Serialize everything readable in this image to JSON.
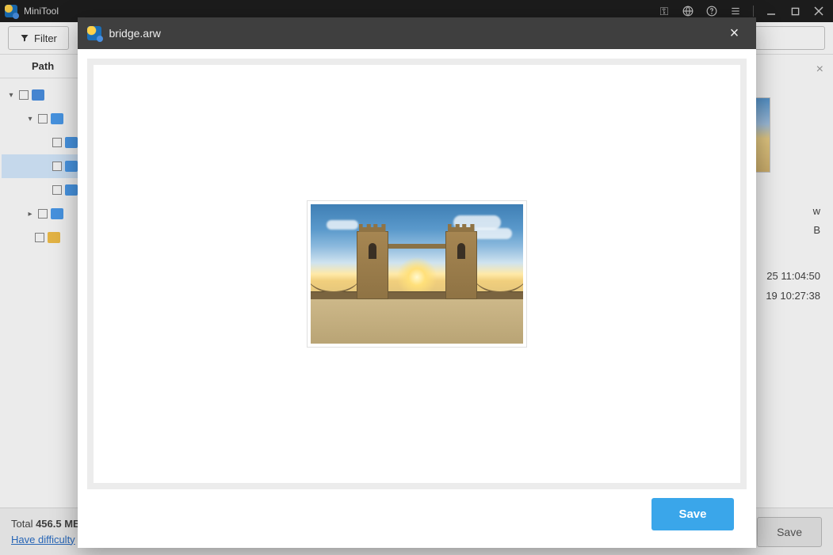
{
  "app": {
    "title_prefix": "MiniTool"
  },
  "toolbar": {
    "filter_label": "Filter"
  },
  "tree": {
    "tab_label": "Path"
  },
  "details": {
    "file_ext_suffix": "w",
    "size_suffix": "B",
    "modified_suffix": "25 11:04:50",
    "created_suffix": "19 10:27:38"
  },
  "footer": {
    "total_prefix": "Total ",
    "total_value": "456.5 MB",
    "help_prefix": "Have difficulty ",
    "save_label": "Save"
  },
  "modal": {
    "title": "bridge.arw",
    "save_label": "Save"
  }
}
